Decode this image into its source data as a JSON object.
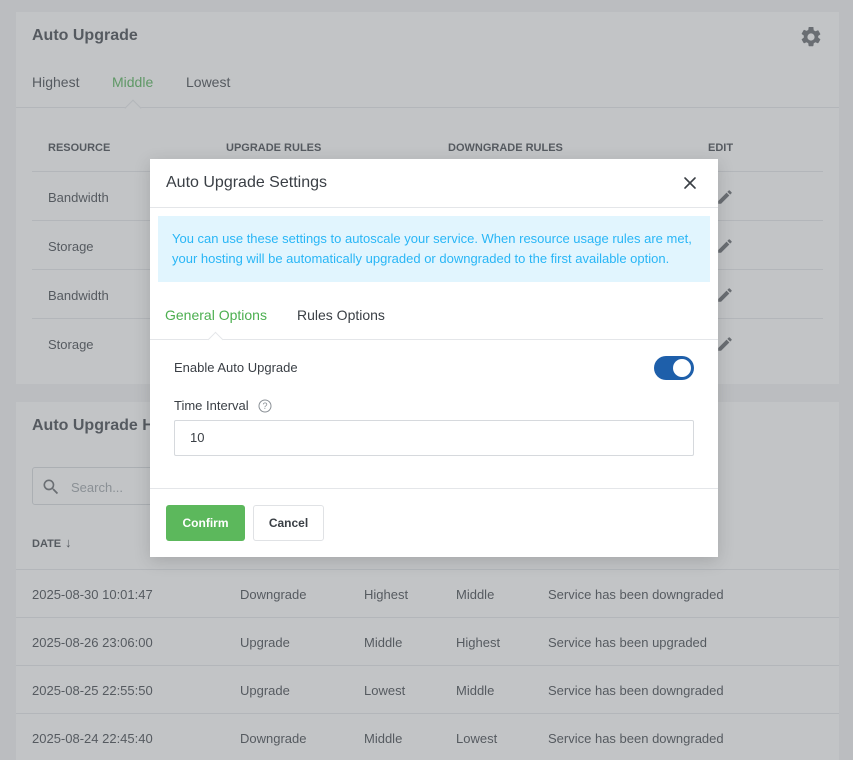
{
  "upgrade_card": {
    "title": "Auto Upgrade",
    "tabs": [
      "Highest",
      "Middle",
      "Lowest"
    ],
    "active_tab": "Middle",
    "columns": [
      "RESOURCE",
      "UPGRADE RULES",
      "DOWNGRADE RULES",
      "EDIT"
    ],
    "rows": [
      "Bandwidth",
      "Storage",
      "Bandwidth",
      "Storage"
    ]
  },
  "history_card": {
    "title": "Auto Upgrade Hi",
    "search_placeholder": "Search...",
    "date_column": "DATE",
    "rows": [
      {
        "date": "2025-08-30 10:01:47",
        "action": "Downgrade",
        "from": "Highest",
        "to": "Middle",
        "message": "Service has been downgraded"
      },
      {
        "date": "2025-08-26 23:06:00",
        "action": "Upgrade",
        "from": "Middle",
        "to": "Highest",
        "message": "Service has been upgraded"
      },
      {
        "date": "2025-08-25 22:55:50",
        "action": "Upgrade",
        "from": "Lowest",
        "to": "Middle",
        "message": "Service has been downgraded"
      },
      {
        "date": "2025-08-24 22:45:40",
        "action": "Downgrade",
        "from": "Middle",
        "to": "Lowest",
        "message": "Service has been downgraded"
      }
    ]
  },
  "modal": {
    "title": "Auto Upgrade Settings",
    "alert": "You can use these settings to autoscale your service. When resource usage rules are met, your hosting will be automatically upgraded or downgraded to the first available option.",
    "tabs": [
      "General Options",
      "Rules Options"
    ],
    "active_tab": "General Options",
    "enable_label": "Enable Auto Upgrade",
    "enable_value": true,
    "interval_label": "Time Interval",
    "interval_value": "10",
    "confirm_label": "Confirm",
    "cancel_label": "Cancel"
  },
  "colors": {
    "accent_green": "#4caf50",
    "toggle_blue": "#1e5faa",
    "alert_bg": "#e1f5fe",
    "alert_text": "#29b6f6"
  }
}
